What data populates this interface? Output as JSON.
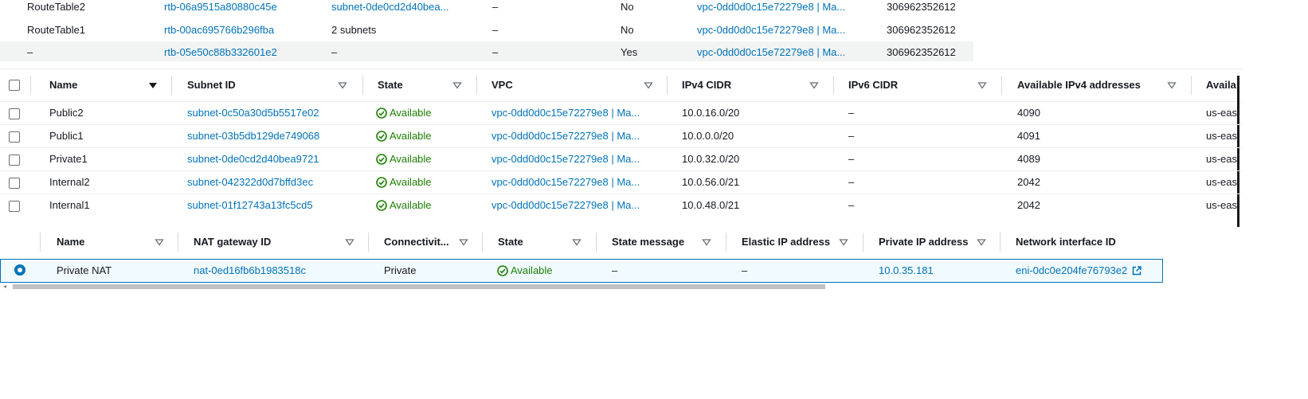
{
  "route_tables": {
    "rows": [
      {
        "name": "RouteTable2",
        "route_table_id": "rtb-06a9515a80880c45e",
        "explicit_assoc": "subnet-0de0cd2d40bea...",
        "edge_assoc": "–",
        "main": "No",
        "vpc": "vpc-0dd0d0c15e72279e8 | Ma...",
        "owner": "306962352612"
      },
      {
        "name": "RouteTable1",
        "route_table_id": "rtb-00ac695766b296fba",
        "explicit_assoc": "2 subnets",
        "edge_assoc": "–",
        "main": "No",
        "vpc": "vpc-0dd0d0c15e72279e8 | Ma...",
        "owner": "306962352612"
      },
      {
        "name": "–",
        "route_table_id": "rtb-05e50c88b332601e2",
        "explicit_assoc": "–",
        "edge_assoc": "–",
        "main": "Yes",
        "vpc": "vpc-0dd0d0c15e72279e8 | Ma...",
        "owner": "306962352612"
      }
    ]
  },
  "subnets": {
    "headers": {
      "name": "Name",
      "subnet_id": "Subnet ID",
      "state": "State",
      "vpc": "VPC",
      "ipv4_cidr": "IPv4 CIDR",
      "ipv6_cidr": "IPv6 CIDR",
      "available_ipv4": "Available IPv4 addresses",
      "az": "Availa"
    },
    "rows": [
      {
        "name": "Public2",
        "subnet_id": "subnet-0c50a30d5b5517e02",
        "state": "Available",
        "vpc": "vpc-0dd0d0c15e72279e8 | Ma...",
        "ipv4_cidr": "10.0.16.0/20",
        "ipv6_cidr": "–",
        "available_ipv4": "4090",
        "az": "us-eas"
      },
      {
        "name": "Public1",
        "subnet_id": "subnet-03b5db129de749068",
        "state": "Available",
        "vpc": "vpc-0dd0d0c15e72279e8 | Ma...",
        "ipv4_cidr": "10.0.0.0/20",
        "ipv6_cidr": "–",
        "available_ipv4": "4091",
        "az": "us-eas"
      },
      {
        "name": "Private1",
        "subnet_id": "subnet-0de0cd2d40bea9721",
        "state": "Available",
        "vpc": "vpc-0dd0d0c15e72279e8 | Ma...",
        "ipv4_cidr": "10.0.32.0/20",
        "ipv6_cidr": "–",
        "available_ipv4": "4089",
        "az": "us-eas"
      },
      {
        "name": "Internal2",
        "subnet_id": "subnet-042322d0d7bffd3ec",
        "state": "Available",
        "vpc": "vpc-0dd0d0c15e72279e8 | Ma...",
        "ipv4_cidr": "10.0.56.0/21",
        "ipv6_cidr": "–",
        "available_ipv4": "2042",
        "az": "us-eas"
      },
      {
        "name": "Internal1",
        "subnet_id": "subnet-01f12743a13fc5cd5",
        "state": "Available",
        "vpc": "vpc-0dd0d0c15e72279e8 | Ma...",
        "ipv4_cidr": "10.0.48.0/21",
        "ipv6_cidr": "–",
        "available_ipv4": "2042",
        "az": "us-eas"
      }
    ]
  },
  "nat_gateways": {
    "headers": {
      "name": "Name",
      "nat_id": "NAT gateway ID",
      "connectivity": "Connectivit...",
      "state": "State",
      "state_message": "State message",
      "elastic_ip": "Elastic IP address",
      "private_ip": "Private IP address",
      "eni": "Network interface ID"
    },
    "rows": [
      {
        "name": "Private NAT",
        "nat_id": "nat-0ed16fb6b1983518c",
        "connectivity": "Private",
        "state": "Available",
        "state_message": "–",
        "elastic_ip": "–",
        "private_ip": "10.0.35.181",
        "eni": "eni-0dc0e204fe76793e2"
      }
    ]
  },
  "colors": {
    "link": "#0073bb",
    "success": "#1d8102",
    "selected_row_bg": "#f1faff",
    "alt_row_bg": "#f2f3f3"
  }
}
